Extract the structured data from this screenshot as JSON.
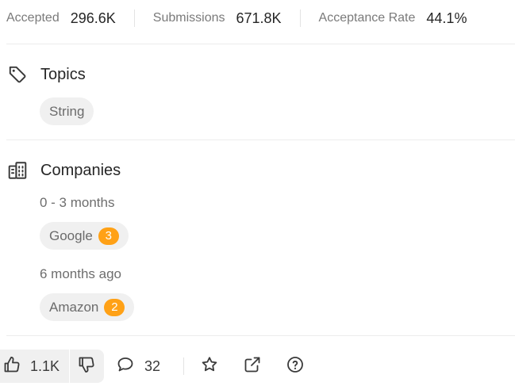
{
  "stats": {
    "accepted_label": "Accepted",
    "accepted_value": "296.6K",
    "submissions_label": "Submissions",
    "submissions_value": "671.8K",
    "acceptance_label": "Acceptance Rate",
    "acceptance_value": "44.1%"
  },
  "topics": {
    "title": "Topics",
    "icon": "tag-icon",
    "tags": [
      "String"
    ]
  },
  "companies": {
    "title": "Companies",
    "icon": "building-icon",
    "groups": [
      {
        "period": "0 - 3 months",
        "companies": [
          {
            "name": "Google",
            "count": "3"
          }
        ]
      },
      {
        "period": "6 months ago",
        "companies": [
          {
            "name": "Amazon",
            "count": "2"
          }
        ]
      }
    ]
  },
  "actions": {
    "likes": "1.1K",
    "comments": "32",
    "like_icon": "thumbs-up-icon",
    "dislike_icon": "thumbs-down-icon",
    "comment_icon": "comment-icon",
    "star_icon": "star-icon",
    "share_icon": "external-link-icon",
    "help_icon": "question-circle-icon"
  },
  "colors": {
    "badge": "#ffa116",
    "tag_bg": "#f0f0f0"
  }
}
